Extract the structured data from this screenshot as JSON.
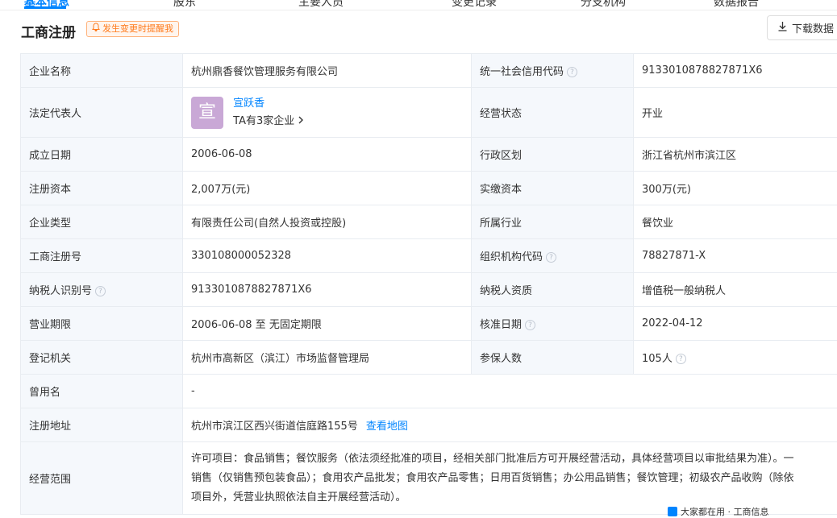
{
  "nav": {
    "tabs": [
      "基本信息",
      "股东",
      "主要人员",
      "变更记录",
      "分支机构",
      "数据报告"
    ]
  },
  "section": {
    "title": "工商注册",
    "alert_label": "发生变更时提醒我",
    "download_label": "下载数据"
  },
  "table": {
    "company_name_label": "企业名称",
    "company_name": "杭州鼎香餐饮管理服务有限公司",
    "credit_code_label": "统一社会信用代码",
    "credit_code": "913301087882787​1X6",
    "rep_label": "法定代表人",
    "rep_avatar": "宣",
    "rep_name": "宣跃香",
    "rep_companies": "TA有3家企业",
    "status_label": "经营状态",
    "status": "开业",
    "founded_label": "成立日期",
    "founded": "2006-06-08",
    "district_label": "行政区划",
    "district": "浙江省杭州市滨江区",
    "capital_label": "注册资本",
    "capital": "2,007万(元)",
    "paid_label": "实缴资本",
    "paid": "300万(元)",
    "type_label": "企业类型",
    "type": "有限责任公司(自然人投资或控股)",
    "industry_label": "所属行业",
    "industry": "餐饮业",
    "reg_no_label": "工商注册号",
    "reg_no": "330108000052328",
    "org_code_label": "组织机构代码",
    "org_code": "78827871-X",
    "taxpayer_id_label": "纳税人识别号",
    "taxpayer_id": "913301087882787​1X6",
    "taxpayer_type_label": "纳税人资质",
    "taxpayer_type": "增值税一般纳税人",
    "term_label": "营业期限",
    "term": "2006-06-08 至 无固定期限",
    "approval_label": "核准日期",
    "approval": "2022-04-12",
    "authority_label": "登记机关",
    "authority": "杭州市高新区（滨江）市场监督管理局",
    "insured_label": "参保人数",
    "insured": "105人",
    "former_name_label": "曾用名",
    "former_name": "-",
    "address_label": "注册地址",
    "address": "杭州市滨江区西兴街道信庭路155号",
    "map_link": "查看地图",
    "scope_label": "经营范围",
    "scope_line1": "许可项目：食品销售；餐饮服务（依法须经批准的项目，经相关部门批准后方可开展经营活动，具体经营项目以审批结果为准）。一",
    "scope_line2": "销售（仅销售预包装食品）；食用农产品批发；食用农产品零售；日用百货销售；办公用品销售；餐饮管理；初级农产品收购（除依",
    "scope_line3": "项目外，凭营业执照依法自主开展经营活动）。"
  },
  "footer_tip": "大家都在用 · 工商信息"
}
